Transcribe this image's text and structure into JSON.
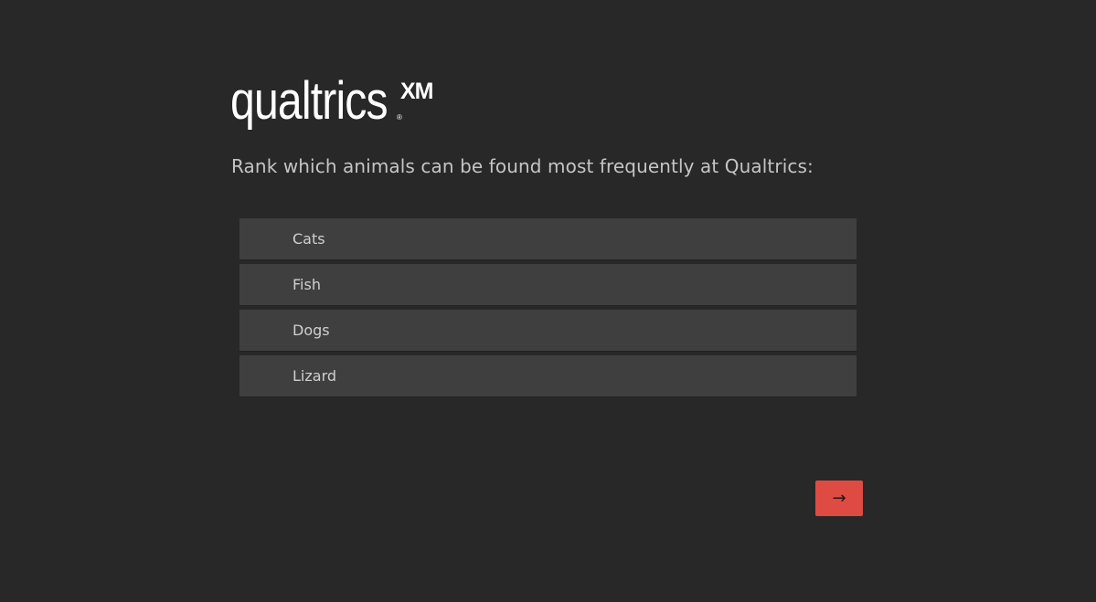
{
  "logo": {
    "wordmark": "qualtrics",
    "registered": "®",
    "suffix": "XM"
  },
  "question": {
    "text": "Rank which animals can be found most frequently at Qualtrics:"
  },
  "rank_items": [
    {
      "label": "Cats"
    },
    {
      "label": "Fish"
    },
    {
      "label": "Dogs"
    },
    {
      "label": "Lizard"
    }
  ],
  "next_button": {
    "icon": "arrow-right-icon",
    "glyph": "→"
  },
  "colors": {
    "background": "#282828",
    "item_background": "#3f3f3f",
    "accent": "#dd4b42",
    "question_text": "#c5c5c5",
    "logo": "#ffffff"
  }
}
